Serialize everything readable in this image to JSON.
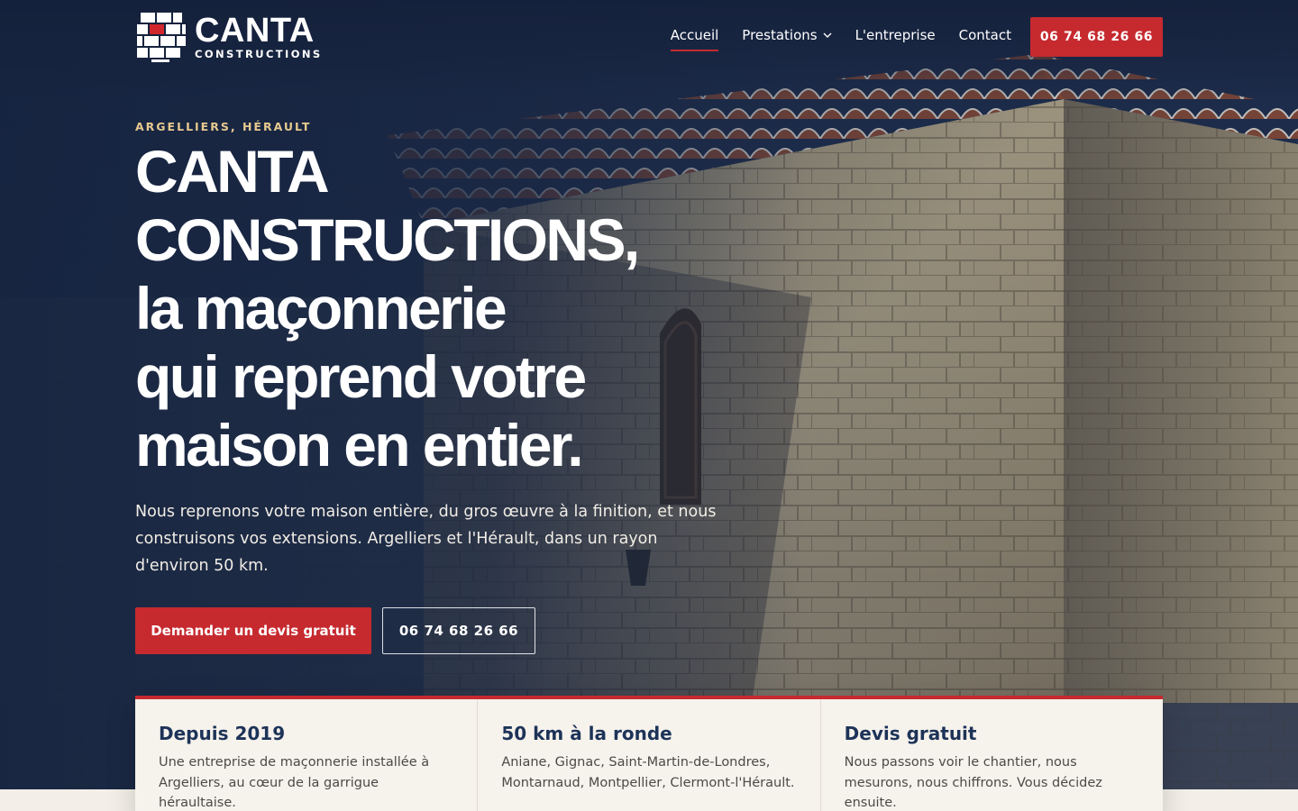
{
  "brand": {
    "name": "CANTA",
    "subtitle": "CONSTRUCTIONS"
  },
  "nav": {
    "items": [
      {
        "label": "Accueil",
        "active": true
      },
      {
        "label": "Prestations",
        "has_dropdown": true
      },
      {
        "label": "L'entreprise"
      },
      {
        "label": "Contact"
      }
    ],
    "phone_cta": "06 74 68 26 66"
  },
  "hero": {
    "eyebrow": "ARGELLIERS, HÉRAULT",
    "headline": [
      "CANTA",
      "CONSTRUCTIONS,",
      "la maçonnerie",
      "qui reprend votre",
      "maison en entier."
    ],
    "lede": "Nous reprenons votre maison entière, du gros œuvre à la finition, et nous construisons vos extensions. Argelliers et l'Hérault, dans un rayon d'environ 50 km.",
    "primary_button": "Demander un devis gratuit",
    "secondary_button": "06 74 68 26 66"
  },
  "features": [
    {
      "title": "Depuis 2019",
      "text": "Une entreprise de maçonnerie installée à Argelliers, au cœur de la garrigue héraultaise."
    },
    {
      "title": "50 km à la ronde",
      "text": "Aniane, Gignac, Saint-Martin-de-Londres, Montarnaud, Montpellier, Clermont-l'Hérault."
    },
    {
      "title": "Devis gratuit",
      "text": "Nous passons voir le chantier, nous mesurons, nous chiffrons. Vous décidez ensuite."
    }
  ],
  "colors": {
    "accent_red": "#c62a2f",
    "navy": "#1d3358",
    "eyebrow_gold": "#e7c98f",
    "card_bg": "#f6f2ec"
  },
  "icons": {
    "logo": "brick-wall-icon",
    "dropdown": "chevron-down-icon"
  }
}
